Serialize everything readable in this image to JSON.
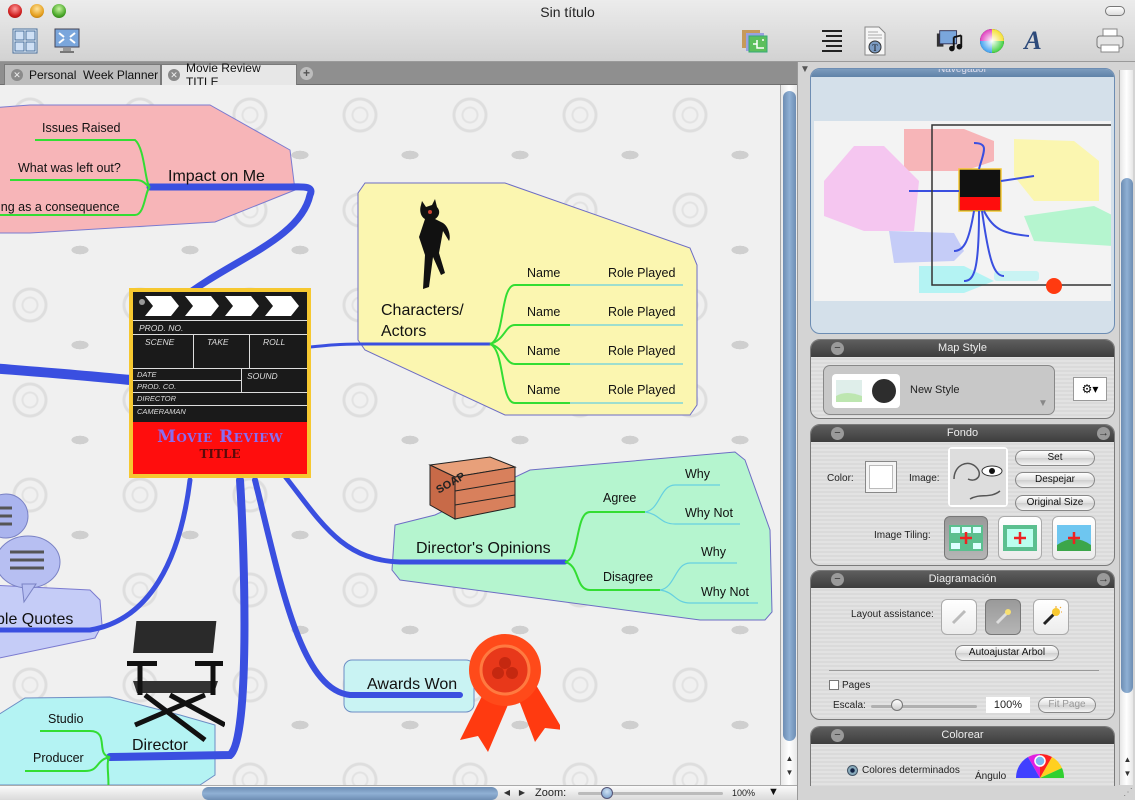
{
  "window": {
    "title": "Sin título",
    "traffic_lights": [
      "close",
      "minimize",
      "zoom"
    ]
  },
  "toolbar": {
    "left": [
      {
        "icon": "layout-grid-icon",
        "name": "grid-view"
      },
      {
        "icon": "fullscreen-icon",
        "name": "full-screen"
      }
    ],
    "right": [
      {
        "icon": "map-structure-icon",
        "name": "map-structure"
      },
      {
        "icon": "outline-text-icon",
        "name": "outline"
      },
      {
        "icon": "document-text-icon",
        "name": "notes"
      },
      {
        "icon": "media-browser-icon",
        "name": "media"
      },
      {
        "icon": "color-wheel-icon",
        "name": "colors"
      },
      {
        "icon": "font-icon",
        "name": "fonts"
      },
      {
        "icon": "printer-icon",
        "name": "print"
      }
    ]
  },
  "tabs": [
    {
      "label": "Personal  Week Planner",
      "active": false
    },
    {
      "label": "Movie Review TITLE",
      "active": true
    }
  ],
  "mindmap": {
    "central": {
      "line1": "PROD. NO.",
      "scene": "SCENE",
      "take": "TAKE",
      "roll": "ROLL",
      "date": "DATE",
      "sound": "SOUND",
      "prod_co": "PROD. CO.",
      "director": "DIRECTOR",
      "cameraman": "CAMERAMAN",
      "title": "Movie Review",
      "subtitle": "TITLE"
    },
    "impact": {
      "label": "Impact on Me",
      "children": [
        "Issues Raised",
        "What was left out?",
        "ing as a consequence"
      ],
      "color": "#f7b5b8"
    },
    "characters": {
      "label_line1": "Characters/",
      "label_line2": "Actors",
      "rows": [
        {
          "name": "Name",
          "role": "Role Played"
        },
        {
          "name": "Name",
          "role": "Role Played"
        },
        {
          "name": "Name",
          "role": "Role Played"
        },
        {
          "name": "Name",
          "role": "Role Played"
        }
      ],
      "color": "#fbf6b0"
    },
    "opinions": {
      "label": "Director's Opinions",
      "agree": "Agree",
      "disagree": "Disagree",
      "why": "Why",
      "why_not": "Why Not",
      "color": "#b5f5cf"
    },
    "quotes": {
      "label": "ble Quotes",
      "color": "#c5ccf7"
    },
    "awards": {
      "label": "Awards Won",
      "color": "#c9f3f3"
    },
    "director": {
      "label": "Director",
      "children": [
        "Studio",
        "Producer"
      ],
      "color": "#b4f3f3"
    }
  },
  "bottom_bar": {
    "zoom_label": "Zoom:",
    "zoom_value": "100%",
    "zoom_fraction": 0.2
  },
  "inspector": {
    "navigator": {
      "title": "Navegador"
    },
    "map_style": {
      "title": "Map Style",
      "style_name": "New Style"
    },
    "fondo": {
      "title": "Fondo",
      "color_label": "Color:",
      "image_label": "Image:",
      "set_button": "Set",
      "clear_button": "Despejar",
      "original_size_button": "Original Size",
      "tiling_label": "Image Tiling:",
      "color_value": "#ffffff"
    },
    "diagramacion": {
      "title": "Diagramación",
      "layout_label": "Layout assistance:",
      "autofit_button": "Autoajustar Arbol",
      "pages_label": "Pages",
      "pages_checked": false,
      "scale_label": "Escala:",
      "scale_value": "100%",
      "fit_page_button": "Fit Page"
    },
    "colorear": {
      "title": "Colorear",
      "option_label": "Colores determinados",
      "option_selected": true,
      "angle_label": "Ángulo"
    }
  }
}
